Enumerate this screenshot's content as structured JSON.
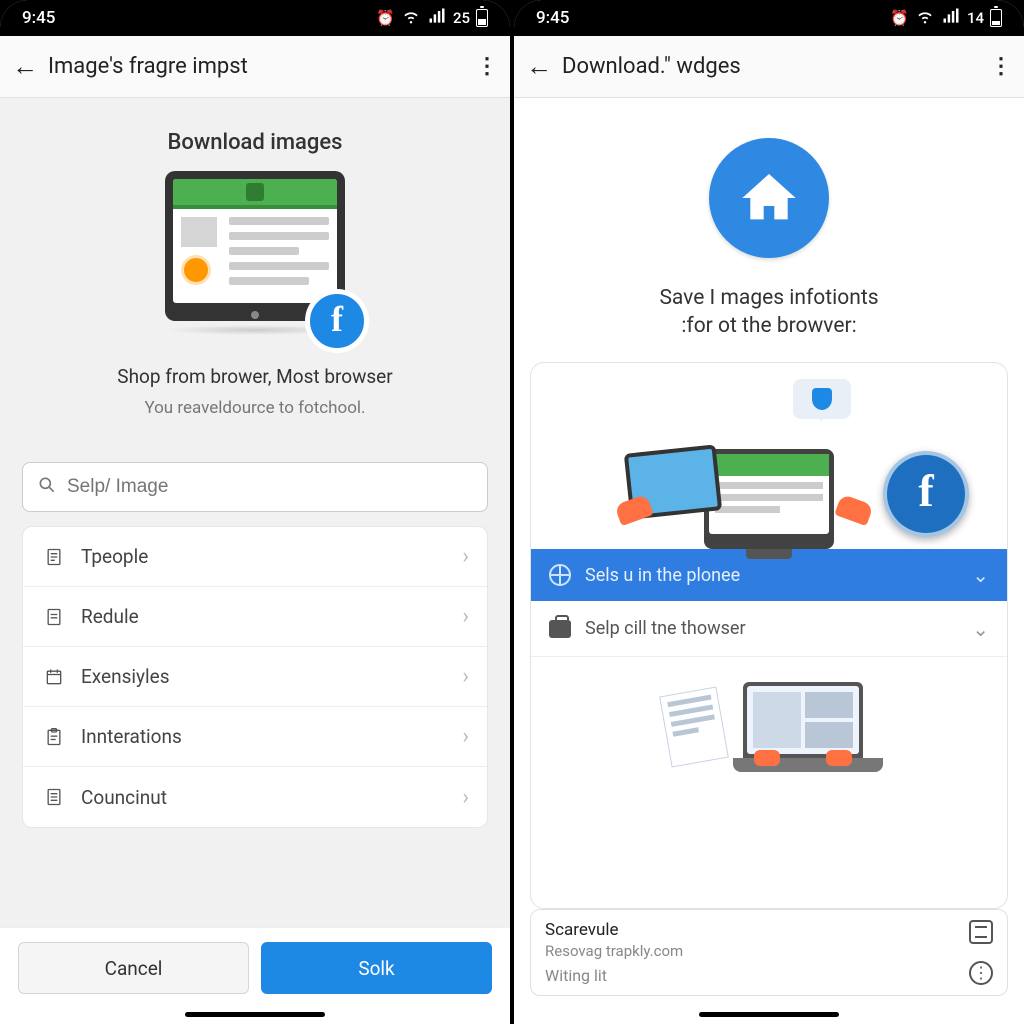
{
  "left": {
    "status": {
      "time": "9:45",
      "battery": "25"
    },
    "appbar": {
      "title": "Image's fragre impst"
    },
    "heading": "Bownload images",
    "subtitle1": "Shop from brower, Most browser",
    "subtitle2": "You reaveldource to fotchool.",
    "search_placeholder": "Selp/ Image",
    "list": [
      {
        "label": "Tpeople"
      },
      {
        "label": "Redule"
      },
      {
        "label": "Exensiyles"
      },
      {
        "label": "Innterations"
      },
      {
        "label": "Councinut"
      }
    ],
    "buttons": {
      "cancel": "Cancel",
      "ok": "Solk"
    }
  },
  "right": {
    "status": {
      "time": "9:45",
      "battery": "14"
    },
    "appbar": {
      "title": "Download.\" wdges"
    },
    "heading1": "Save I mages infotionts",
    "heading2": ":for ot the browver:",
    "blue_row": "Sels u in the plonee",
    "grey_row": "Selp cill tne thowser",
    "bottom_card": {
      "title": "Scarevule",
      "subtitle": "Resovag trapkly.com",
      "status": "Witing lit"
    }
  }
}
